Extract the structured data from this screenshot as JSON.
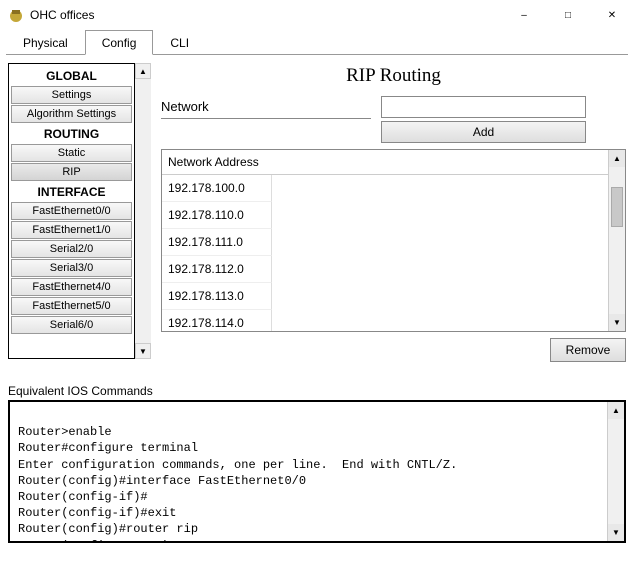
{
  "window": {
    "title": "OHC offices"
  },
  "tabs": [
    "Physical",
    "Config",
    "CLI"
  ],
  "activeTab": 1,
  "sidebar": {
    "sections": [
      {
        "header": "GLOBAL",
        "items": [
          "Settings",
          "Algorithm Settings"
        ]
      },
      {
        "header": "ROUTING",
        "items": [
          "Static",
          "RIP"
        ]
      },
      {
        "header": "INTERFACE",
        "items": [
          "FastEthernet0/0",
          "FastEthernet1/0",
          "Serial2/0",
          "Serial3/0",
          "FastEthernet4/0",
          "FastEthernet5/0",
          "Serial6/0"
        ]
      }
    ],
    "selected": "RIP"
  },
  "main": {
    "title": "RIP Routing",
    "networkLabel": "Network",
    "addLabel": "Add",
    "removeLabel": "Remove",
    "tableHeader": "Network Address",
    "networks": [
      "192.178.100.0",
      "192.178.110.0",
      "192.178.111.0",
      "192.178.112.0",
      "192.178.113.0",
      "192.178.114.0"
    ]
  },
  "ios": {
    "label": "Equivalent IOS Commands",
    "lines": [
      "",
      "Router>enable",
      "Router#configure terminal",
      "Enter configuration commands, one per line.  End with CNTL/Z.",
      "Router(config)#interface FastEthernet0/0",
      "Router(config-if)#",
      "Router(config-if)#exit",
      "Router(config)#router rip",
      "Router(config-router)#"
    ]
  }
}
